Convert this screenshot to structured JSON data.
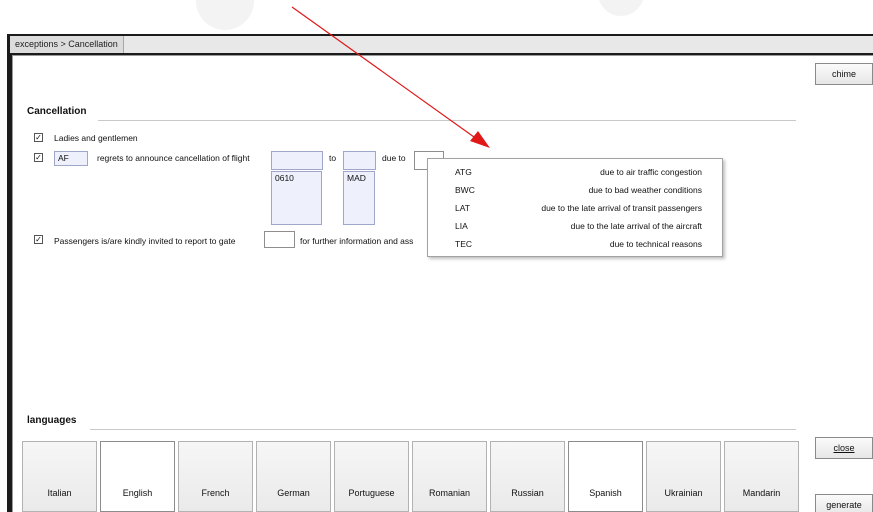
{
  "window": {
    "title": "exceptions > Cancellation"
  },
  "buttons": {
    "chime": "chime",
    "close": "close",
    "generate": "generate"
  },
  "cancellation": {
    "heading": "Cancellation",
    "line1": {
      "checked": true,
      "text": "Ladies and gentlemen"
    },
    "line2": {
      "checked": true,
      "airline": "AF",
      "text": "regrets to announce cancellation of  flight",
      "flight_value": "",
      "to_label": "to",
      "to_value": "",
      "due_label": "due to",
      "due_value": "",
      "flight_list": [
        "0610"
      ],
      "destination_list": [
        "MAD"
      ]
    },
    "line3": {
      "checked": true,
      "text": "Passengers is/are kindly invited to report to gate",
      "gate_value": "",
      "suffix": "for further information and ass"
    }
  },
  "reasons_dropdown": [
    {
      "code": "ATG",
      "description": "due to air traffic congestion"
    },
    {
      "code": "BWC",
      "description": "due to bad weather conditions"
    },
    {
      "code": "LAT",
      "description": "due to the late arrival of transit passengers"
    },
    {
      "code": "LIA",
      "description": "due to the late arrival of the aircraft"
    },
    {
      "code": "TEC",
      "description": "due to technical reasons"
    }
  ],
  "languages": {
    "heading": "languages",
    "items": [
      {
        "label": "Italian",
        "active": false
      },
      {
        "label": "English",
        "active": true
      },
      {
        "label": "French",
        "active": false
      },
      {
        "label": "German",
        "active": false
      },
      {
        "label": "Portuguese",
        "active": false
      },
      {
        "label": "Romanian",
        "active": false
      },
      {
        "label": "Russian",
        "active": false
      },
      {
        "label": "Spanish",
        "active": true
      },
      {
        "label": "Ukrainian",
        "active": false
      },
      {
        "label": "Mandarin",
        "active": false
      }
    ]
  },
  "colors": {
    "annotation_arrow": "#e01818",
    "field_fill": "#eef0fb"
  }
}
